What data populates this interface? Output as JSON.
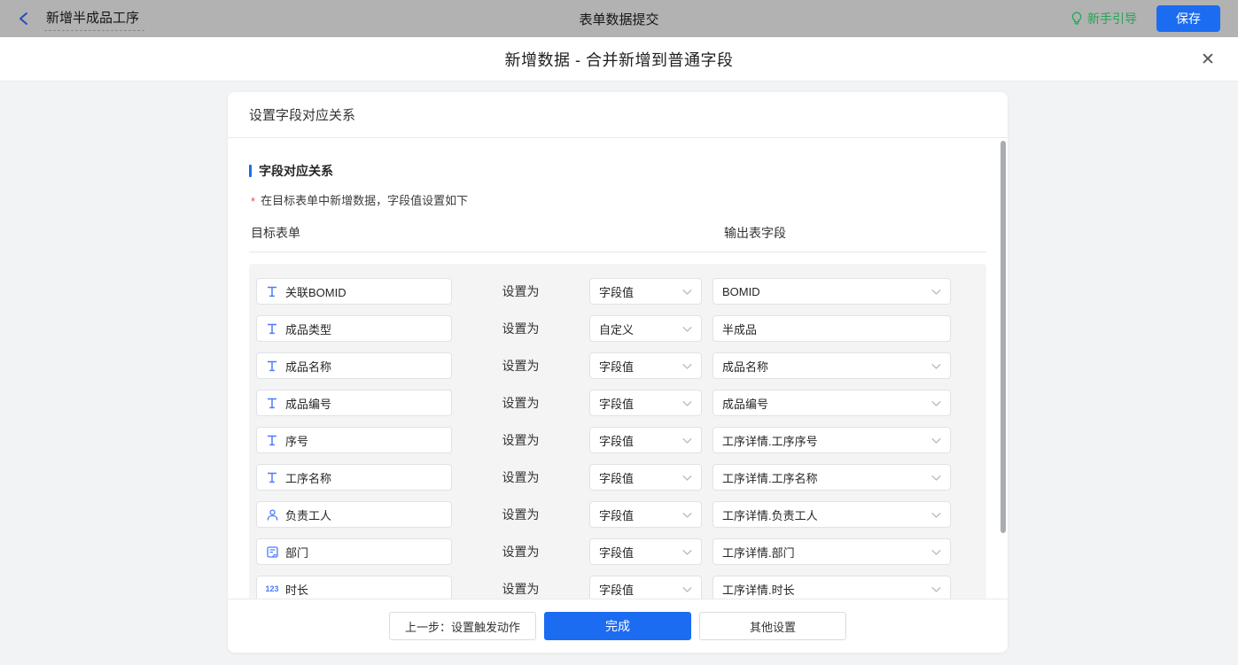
{
  "topbar": {
    "back_label": "新增半成品工序",
    "center_title": "表单数据提交",
    "guide_label": "新手引导",
    "save_label": "保存"
  },
  "modal": {
    "title": "新增数据 - 合并新增到普通字段",
    "close_glyph": "✕"
  },
  "panel": {
    "header": "设置字段对应关系",
    "section_title": "字段对应关系",
    "required_mark": "*",
    "hint": "在目标表单中新增数据，字段值设置如下",
    "col_left": "目标表单",
    "col_right": "输出表字段",
    "set_as_label": "设置为"
  },
  "mapping": {
    "rows": [
      {
        "icon": "text",
        "field": "关联BOMID",
        "type": "字段值",
        "output": "BOMID",
        "output_kind": "select"
      },
      {
        "icon": "text",
        "field": "成品类型",
        "type": "自定义",
        "output": "半成品",
        "output_kind": "input"
      },
      {
        "icon": "text",
        "field": "成品名称",
        "type": "字段值",
        "output": "成品名称",
        "output_kind": "select"
      },
      {
        "icon": "text",
        "field": "成品编号",
        "type": "字段值",
        "output": "成品编号",
        "output_kind": "select"
      },
      {
        "icon": "text",
        "field": "序号",
        "type": "字段值",
        "output": "工序详情.工序序号",
        "output_kind": "select"
      },
      {
        "icon": "text",
        "field": "工序名称",
        "type": "字段值",
        "output": "工序详情.工序名称",
        "output_kind": "select"
      },
      {
        "icon": "user",
        "field": "负责工人",
        "type": "字段值",
        "output": "工序详情.负责工人",
        "output_kind": "select"
      },
      {
        "icon": "dept",
        "field": "部门",
        "type": "字段值",
        "output": "工序详情.部门",
        "output_kind": "select"
      },
      {
        "icon": "number",
        "field": "时长",
        "type": "字段值",
        "output": "工序详情.时长",
        "output_kind": "select"
      },
      {
        "icon": "",
        "field": "",
        "type": "",
        "output": "",
        "output_kind": "select",
        "partial": true
      }
    ],
    "number_icon_text": "123"
  },
  "footer": {
    "prev_label": "上一步：设置触发动作",
    "done_label": "完成",
    "other_label": "其他设置"
  },
  "colors": {
    "accent": "#1c6cf2",
    "icon_blue": "#4c7aff",
    "green": "#21a656",
    "required_red": "#e34d59"
  }
}
